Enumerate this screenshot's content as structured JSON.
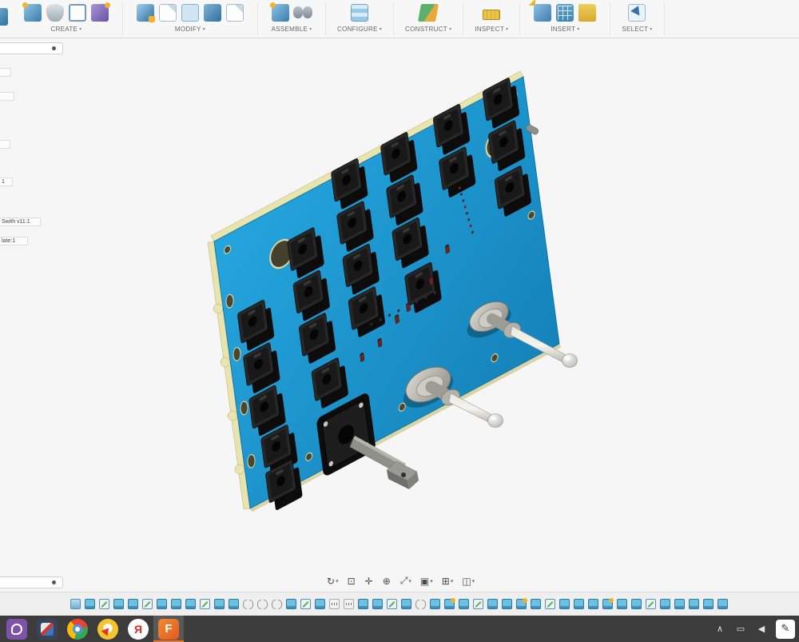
{
  "colors": {
    "accent_blue": "#1c9cd8",
    "plate_blue": "#1d9bd6",
    "plate_edge_cream": "#e9e3ad",
    "switch_black": "#1a1a1a",
    "toggle_metal": "#c0c0b8",
    "canvas_bg": "#f6f6f6",
    "toolbar_bg": "#f7f7f7",
    "timeline_bg": "#efefef",
    "taskbar_bg": "#3c3c3c",
    "fusion_orange": "#e8742a"
  },
  "toolbar": {
    "groups": [
      {
        "label": "CREATE",
        "caret": "▾",
        "icons": [
          "box-star",
          "cylinder",
          "crop",
          "cube-purple"
        ]
      },
      {
        "label": "MODIFY",
        "caret": "▾",
        "icons": [
          "press-pull",
          "sheet",
          "sheet-blue",
          "box",
          "sheet"
        ]
      },
      {
        "label": "ASSEMBLE",
        "caret": "▾",
        "icons": [
          "box-star",
          "binoculars"
        ]
      },
      {
        "label": "CONFIGURE",
        "caret": "▾",
        "icons": [
          "table"
        ]
      },
      {
        "label": "CONSTRUCT",
        "caret": "▾",
        "icons": [
          "planes"
        ]
      },
      {
        "label": "INSPECT",
        "caret": "▾",
        "icons": [
          "ruler"
        ]
      },
      {
        "label": "INSERT",
        "caret": "▾",
        "icons": [
          "insert-arrow",
          "grid-blue",
          "folder"
        ]
      },
      {
        "label": "SELECT",
        "caret": "▾",
        "icons": [
          "cursor"
        ]
      }
    ]
  },
  "browser": {
    "items": [
      {
        "label": ""
      },
      {
        "label": ""
      },
      {
        "label": ""
      },
      {
        "label": "1"
      },
      {
        "label": "Swith v11:1"
      },
      {
        "label": "late:1"
      }
    ]
  },
  "navbar": {
    "items": [
      {
        "name": "orbit",
        "glyph": "↻",
        "caret": "▾"
      },
      {
        "name": "look-at",
        "glyph": "⊡",
        "caret": ""
      },
      {
        "name": "pan",
        "glyph": "✛",
        "caret": ""
      },
      {
        "name": "zoom",
        "glyph": "⊕",
        "caret": ""
      },
      {
        "name": "fit",
        "glyph": "⤢",
        "caret": "▾"
      },
      {
        "name": "display-settings",
        "glyph": "▣",
        "caret": "▾"
      },
      {
        "name": "grid-and-snaps",
        "glyph": "⊞",
        "caret": "▾"
      },
      {
        "name": "viewports",
        "glyph": "◫",
        "caret": "▾"
      }
    ]
  },
  "timeline": {
    "features": [
      "doc",
      "comp",
      "sketch",
      "comp",
      "comp",
      "sketch",
      "comp",
      "comp",
      "comp",
      "sketch",
      "comp",
      "comp",
      "joint",
      "joint",
      "joint",
      "comp",
      "sketch",
      "comp",
      "binary",
      "binary",
      "comp",
      "comp",
      "sketch",
      "comp",
      "joint",
      "comp",
      "gold",
      "comp",
      "sketch",
      "comp",
      "comp",
      "gold",
      "comp",
      "sketch",
      "comp",
      "comp",
      "comp",
      "gold",
      "comp",
      "comp",
      "sketch",
      "comp",
      "comp",
      "comp",
      "comp",
      "comp"
    ]
  },
  "taskbar": {
    "apps": [
      {
        "icon": "viber",
        "letter": "",
        "active_class": ""
      },
      {
        "icon": "generic",
        "letter": "",
        "active_class": ""
      },
      {
        "icon": "chrome",
        "letter": "",
        "active_class": ""
      },
      {
        "icon": "ybrowser",
        "letter": "",
        "active_class": ""
      },
      {
        "icon": "yandex",
        "letter": "Я",
        "active_class": ""
      },
      {
        "icon": "fusion",
        "letter": "F",
        "active_class": "active"
      }
    ],
    "tray": [
      {
        "name": "hidden-icons-expand",
        "glyph": "∧",
        "cls": ""
      },
      {
        "name": "display",
        "glyph": "▭",
        "cls": ""
      },
      {
        "name": "volume",
        "glyph": "◀",
        "cls": ""
      },
      {
        "name": "pen-input",
        "glyph": "✎",
        "cls": "tray-white"
      }
    ]
  }
}
